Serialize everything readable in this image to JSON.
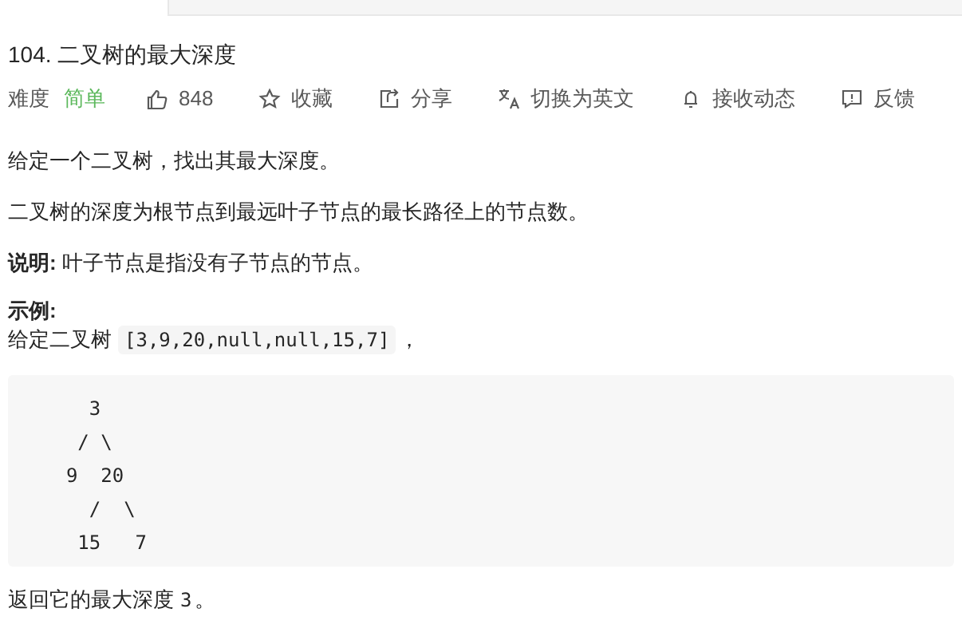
{
  "title": "104. 二叉树的最大深度",
  "toolbar": {
    "difficulty_label": "难度",
    "difficulty": "简单",
    "actions": [
      {
        "kind": "like",
        "label": "848"
      },
      {
        "kind": "favorite",
        "label": "收藏"
      },
      {
        "kind": "share",
        "label": "分享"
      },
      {
        "kind": "translate",
        "label": "切换为英文"
      },
      {
        "kind": "notify",
        "label": "接收动态"
      },
      {
        "kind": "feedback",
        "label": "反馈"
      }
    ]
  },
  "paragraphs": [
    {
      "text": "给定一个二叉树，找出其最大深度。"
    },
    {
      "text": "二叉树的深度为根节点到最远叶子节点的最长路径上的节点数。"
    },
    {
      "text": "**说明:** 叶子节点是指没有子节点的节点。"
    }
  ],
  "example_heading": "示例:",
  "example_intro": {
    "text": "给定二叉树",
    "code": "[3,9,20,null,null,15,7]",
    "after": "，"
  },
  "code_block": [
    "    3",
    "   / \\",
    "  9  20",
    "    /  \\",
    "   15   7"
  ],
  "result": {
    "text": "返回它的最大深度",
    "code": "3",
    "after": "。"
  }
}
